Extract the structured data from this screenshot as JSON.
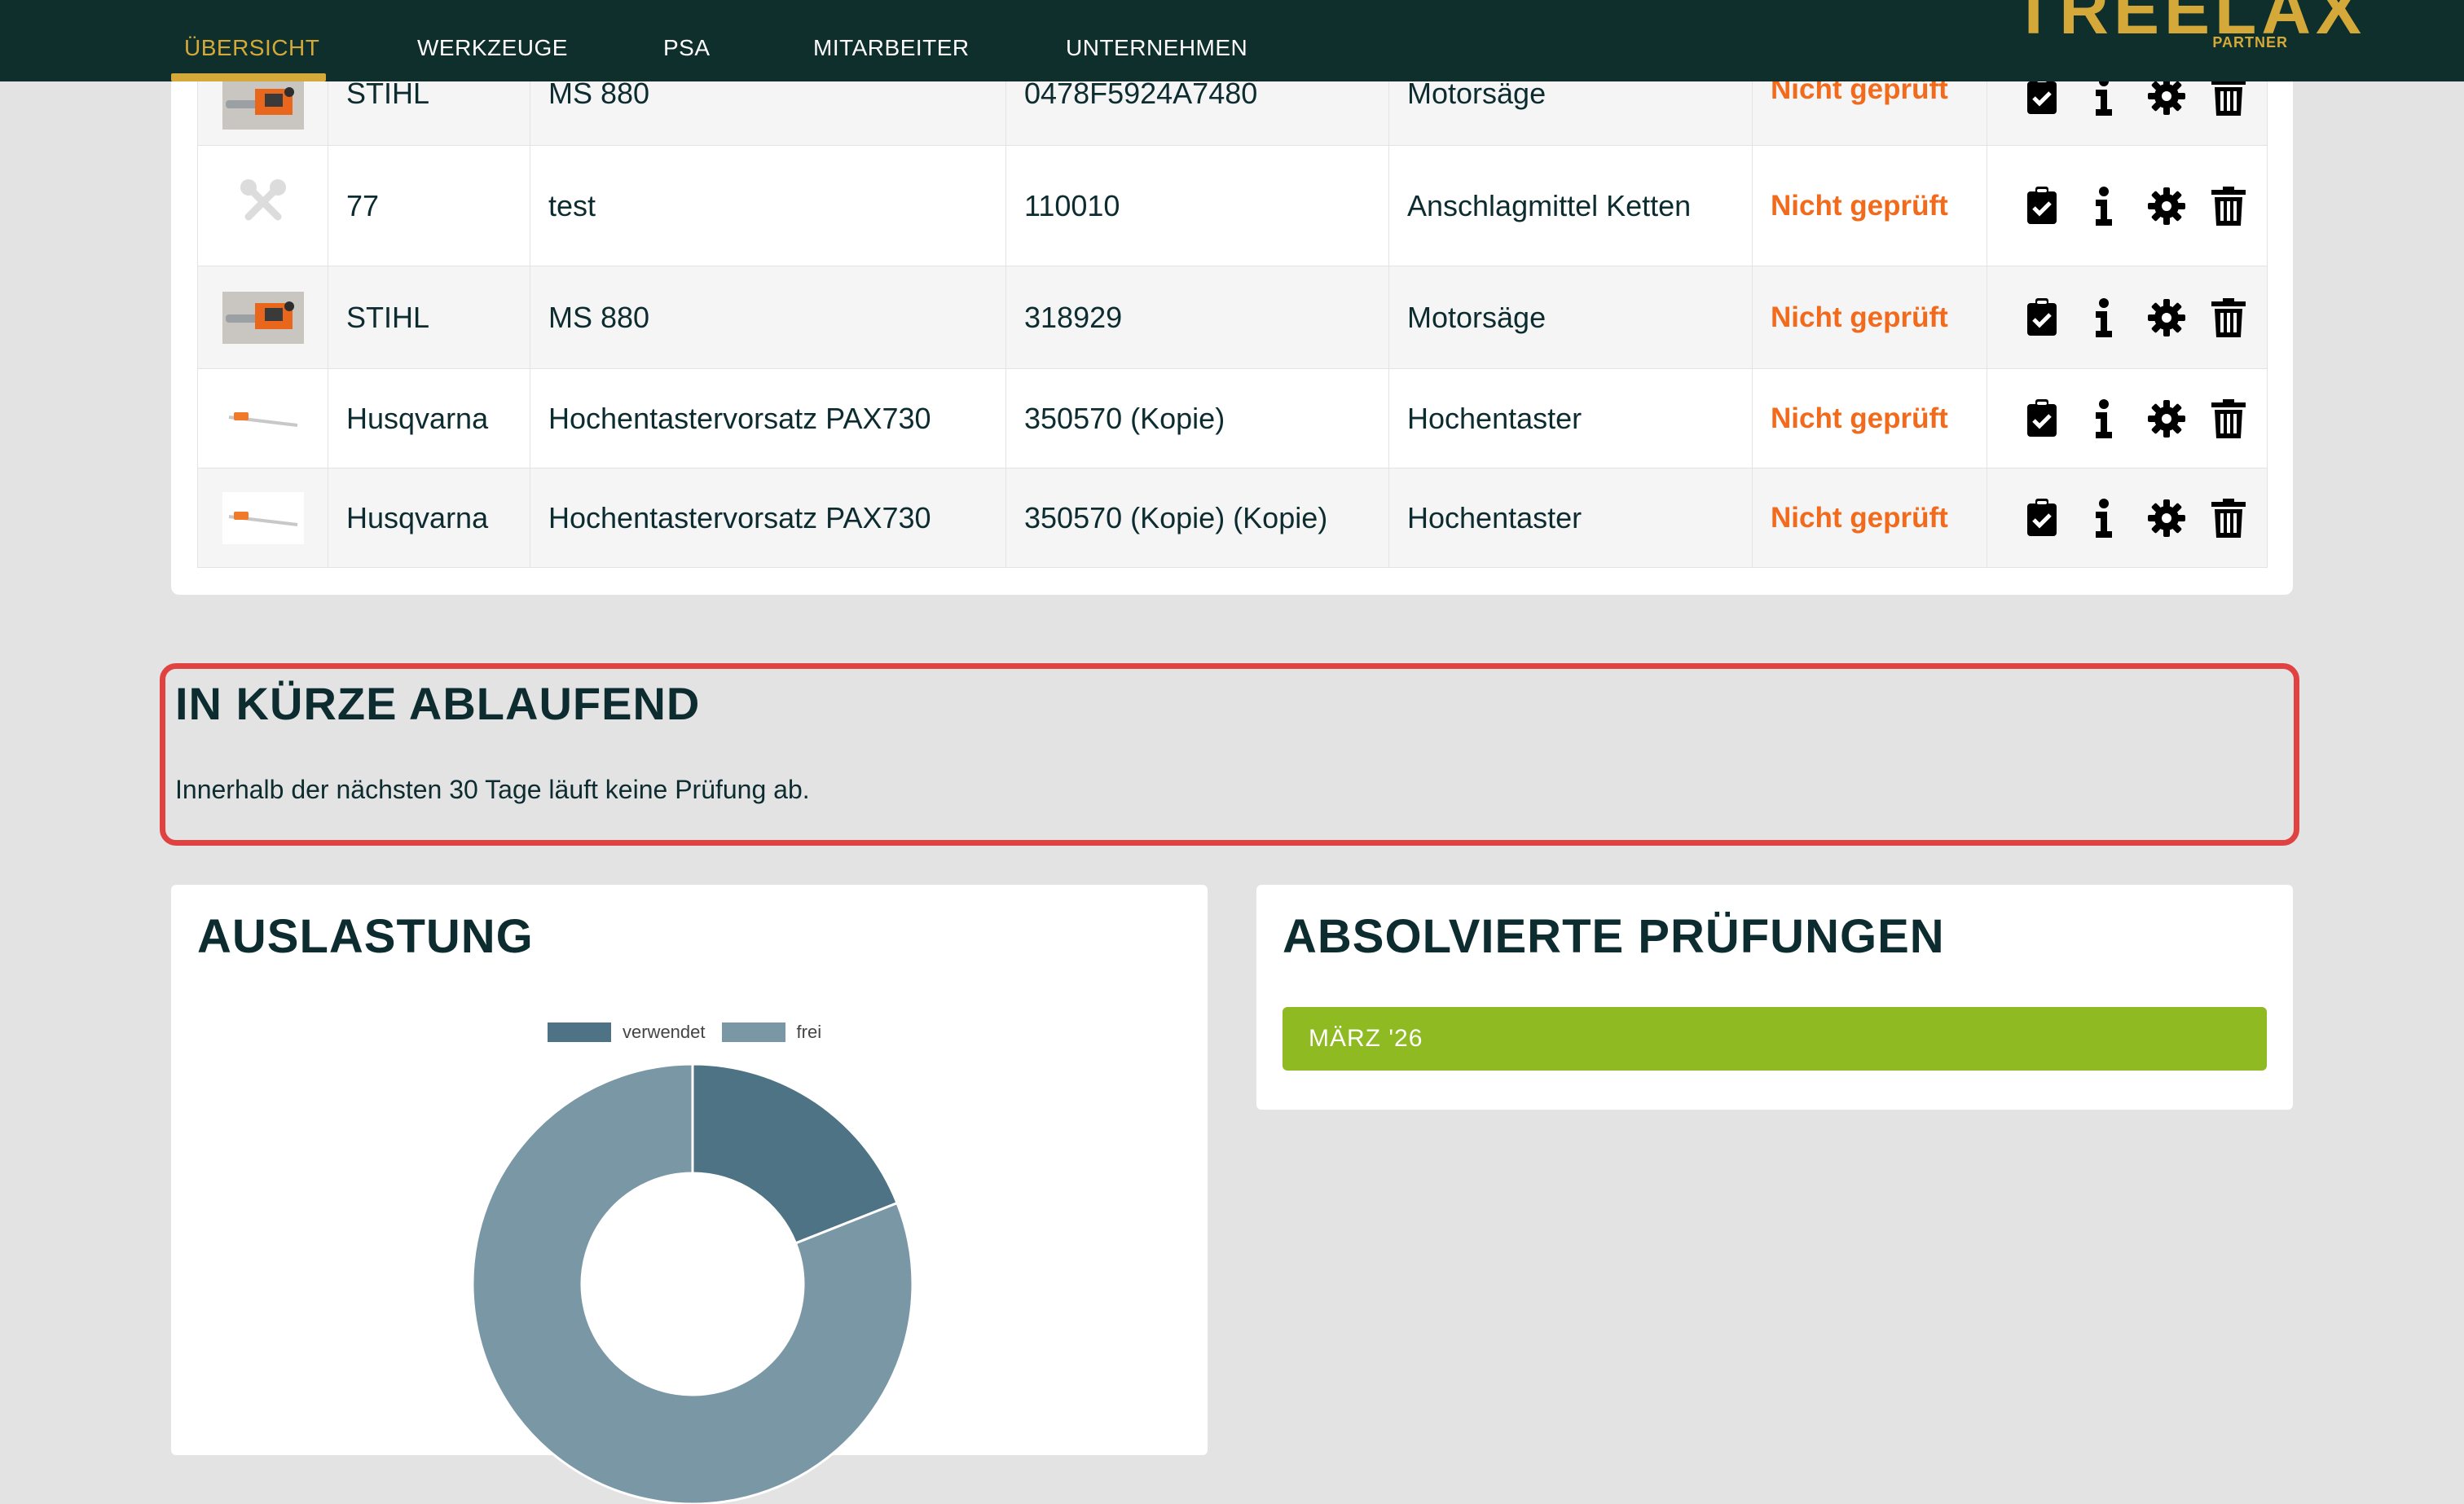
{
  "nav": {
    "items": [
      {
        "label": "ÜBERSICHT",
        "active": true
      },
      {
        "label": "WERKZEUGE",
        "active": false
      },
      {
        "label": "PSA",
        "active": false
      },
      {
        "label": "MITARBEITER",
        "active": false
      },
      {
        "label": "UNTERNEHMEN",
        "active": false
      }
    ],
    "logo": "TREELAX",
    "logo_sub": "PARTNER"
  },
  "tools_table": {
    "rows": [
      {
        "thumb": "chainsaw-image",
        "brand": "STIHL",
        "model": "MS 880",
        "serial": "0478F5924A7480",
        "category": "Motorsäge",
        "status": "Nicht geprüft"
      },
      {
        "thumb": "tools-icon",
        "brand": "77",
        "model": "test",
        "serial": "110010",
        "category": "Anschlagmittel Ketten",
        "status": "Nicht geprüft"
      },
      {
        "thumb": "chainsaw-image",
        "brand": "STIHL",
        "model": "MS 880",
        "serial": "318929",
        "category": "Motorsäge",
        "status": "Nicht geprüft"
      },
      {
        "thumb": "pole-saw-image",
        "brand": "Husqvarna",
        "model": "Hochentastervorsatz PAX730",
        "serial": "350570 (Kopie)",
        "category": "Hochentaster",
        "status": "Nicht geprüft"
      },
      {
        "thumb": "pole-saw-image",
        "brand": "Husqvarna",
        "model": "Hochentastervorsatz PAX730",
        "serial": "350570 (Kopie) (Kopie)",
        "category": "Hochentaster",
        "status": "Nicht geprüft"
      }
    ],
    "action_icons": [
      "clipboard-check-icon",
      "info-icon",
      "gear-icon",
      "trash-icon"
    ]
  },
  "expiring": {
    "title": "IN KÜRZE ABLAUFEND",
    "message": "Innerhalb der nächsten 30 Tage läuft keine Prüfung ab."
  },
  "utilization": {
    "title": "AUSLASTUNG"
  },
  "chart_data": {
    "type": "pie",
    "variant": "doughnut",
    "legend_position": "top",
    "categories": [
      "verwendet",
      "frei"
    ],
    "values": [
      19,
      81
    ],
    "colors": [
      "#4e7385",
      "#7a97a6"
    ]
  },
  "exams": {
    "title": "ABSOLVIERTE PRÜFUNGEN",
    "month": "MÄRZ '26"
  },
  "colors": {
    "header_bg": "#0e2f2b",
    "accent_gold": "#d4a93a",
    "status_orange": "#f26a1b",
    "highlight_red": "#e04242",
    "month_green": "#8fba22"
  }
}
